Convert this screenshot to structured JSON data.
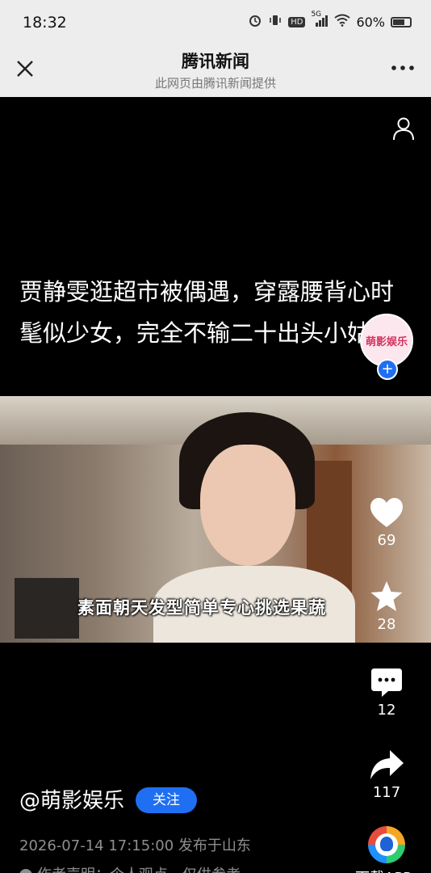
{
  "status_bar": {
    "time": "18:32",
    "network": "5G",
    "hd": "HD",
    "battery": "60%"
  },
  "header": {
    "title": "腾讯新闻",
    "subtitle": "此网页由腾讯新闻提供"
  },
  "video": {
    "title": "贾静雯逛超市被偶遇，穿露腰背心时髦似少女，完全不输二十出头小姑娘",
    "subtitle": "素面朝天发型简单专心挑选果蔬"
  },
  "actions": {
    "avatar_text": "萌影娱乐",
    "like_count": "69",
    "favorite_count": "28",
    "comment_count": "12",
    "share_count": "117"
  },
  "author": {
    "name": "@萌影娱乐",
    "follow_label": "关注",
    "publish_info": "2026-07-14 17:15:00 发布于山东",
    "disclaimer": "作者声明：个人观点，仅供参考"
  },
  "download_label": "下载APP",
  "colors": {
    "accent": "#1f6ff3",
    "header_bg": "#ededed",
    "page_bg": "#000000"
  }
}
